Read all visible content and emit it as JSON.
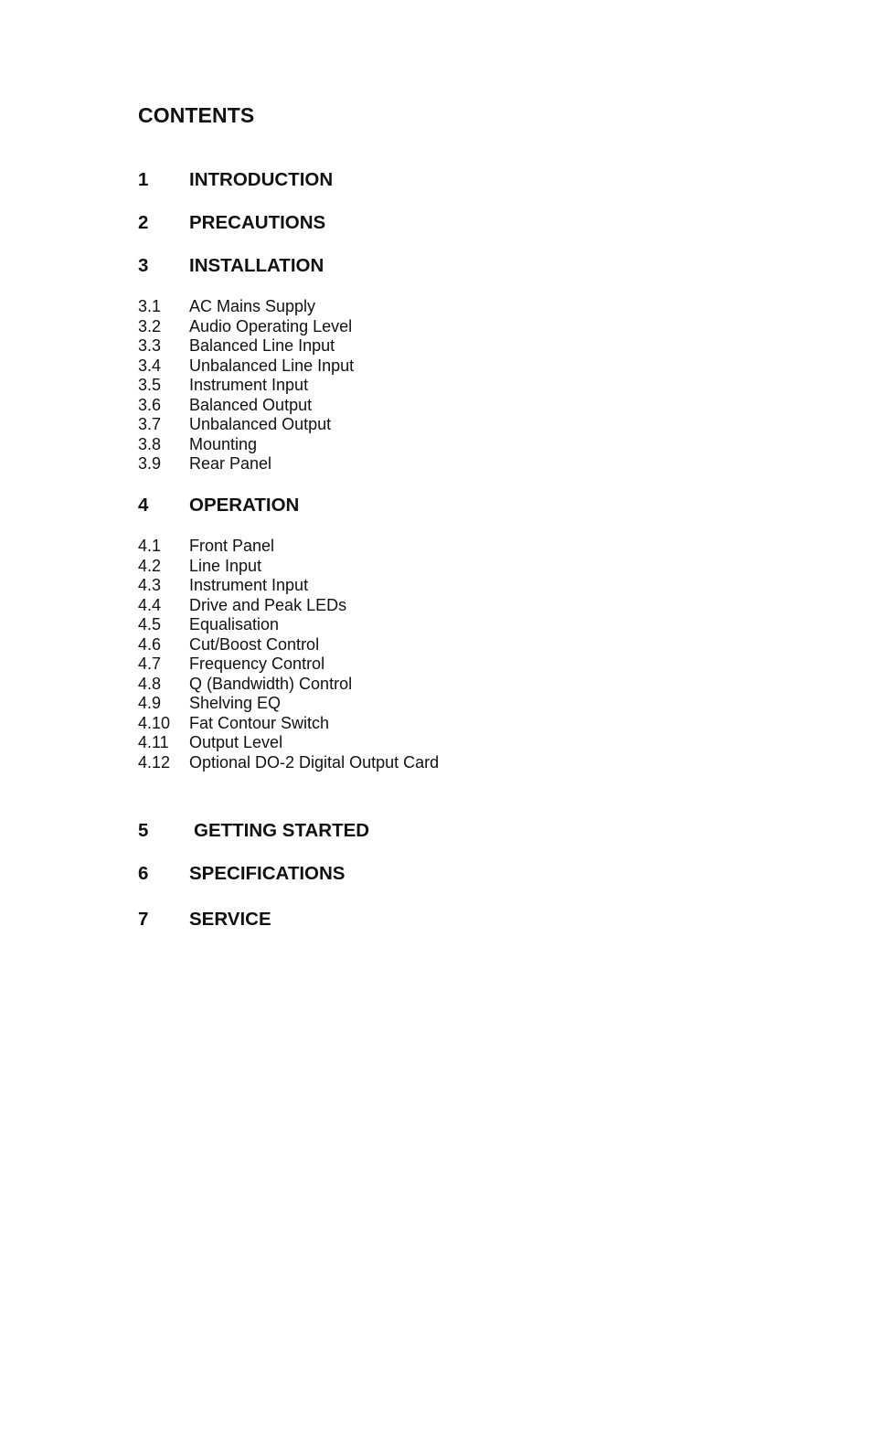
{
  "document": {
    "title": "CONTENTS",
    "sections": [
      {
        "number": "1",
        "label": "INTRODUCTION"
      },
      {
        "number": "2",
        "label": "PRECAUTIONS"
      },
      {
        "number": "3",
        "label": "INSTALLATION",
        "subsections": [
          {
            "number": "3.1",
            "label": "AC Mains Supply"
          },
          {
            "number": "3.2",
            "label": "Audio Operating Level"
          },
          {
            "number": "3.3",
            "label": "Balanced Line Input"
          },
          {
            "number": "3.4",
            "label": "Unbalanced Line Input"
          },
          {
            "number": "3.5",
            "label": "Instrument Input"
          },
          {
            "number": "3.6",
            "label": "Balanced Output"
          },
          {
            "number": "3.7",
            "label": "Unbalanced Output"
          },
          {
            "number": "3.8",
            "label": "Mounting"
          },
          {
            "number": "3.9",
            "label": "Rear Panel"
          }
        ]
      },
      {
        "number": "4",
        "label": "OPERATION",
        "subsections": [
          {
            "number": "4.1",
            "label": "Front Panel"
          },
          {
            "number": "4.2",
            "label": "Line Input"
          },
          {
            "number": "4.3",
            "label": "Instrument Input"
          },
          {
            "number": "4.4",
            "label": "Drive and Peak LEDs"
          },
          {
            "number": "4.5",
            "label": "Equalisation"
          },
          {
            "number": "4.6",
            "label": "Cut/Boost Control"
          },
          {
            "number": "4.7",
            "label": "Frequency Control"
          },
          {
            "number": "4.8",
            "label": "Q (Bandwidth) Control"
          },
          {
            "number": "4.9",
            "label": "Shelving EQ"
          },
          {
            "number": "4.10",
            "label": "Fat Contour Switch"
          },
          {
            "number": "4.11",
            "label": "Output Level"
          },
          {
            "number": "4.12",
            "label": "Optional DO-2 Digital Output Card"
          }
        ]
      },
      {
        "number": "5",
        "label": "GETTING STARTED"
      },
      {
        "number": "6",
        "label": "SPECIFICATIONS"
      },
      {
        "number": "7",
        "label": "SERVICE"
      }
    ]
  }
}
